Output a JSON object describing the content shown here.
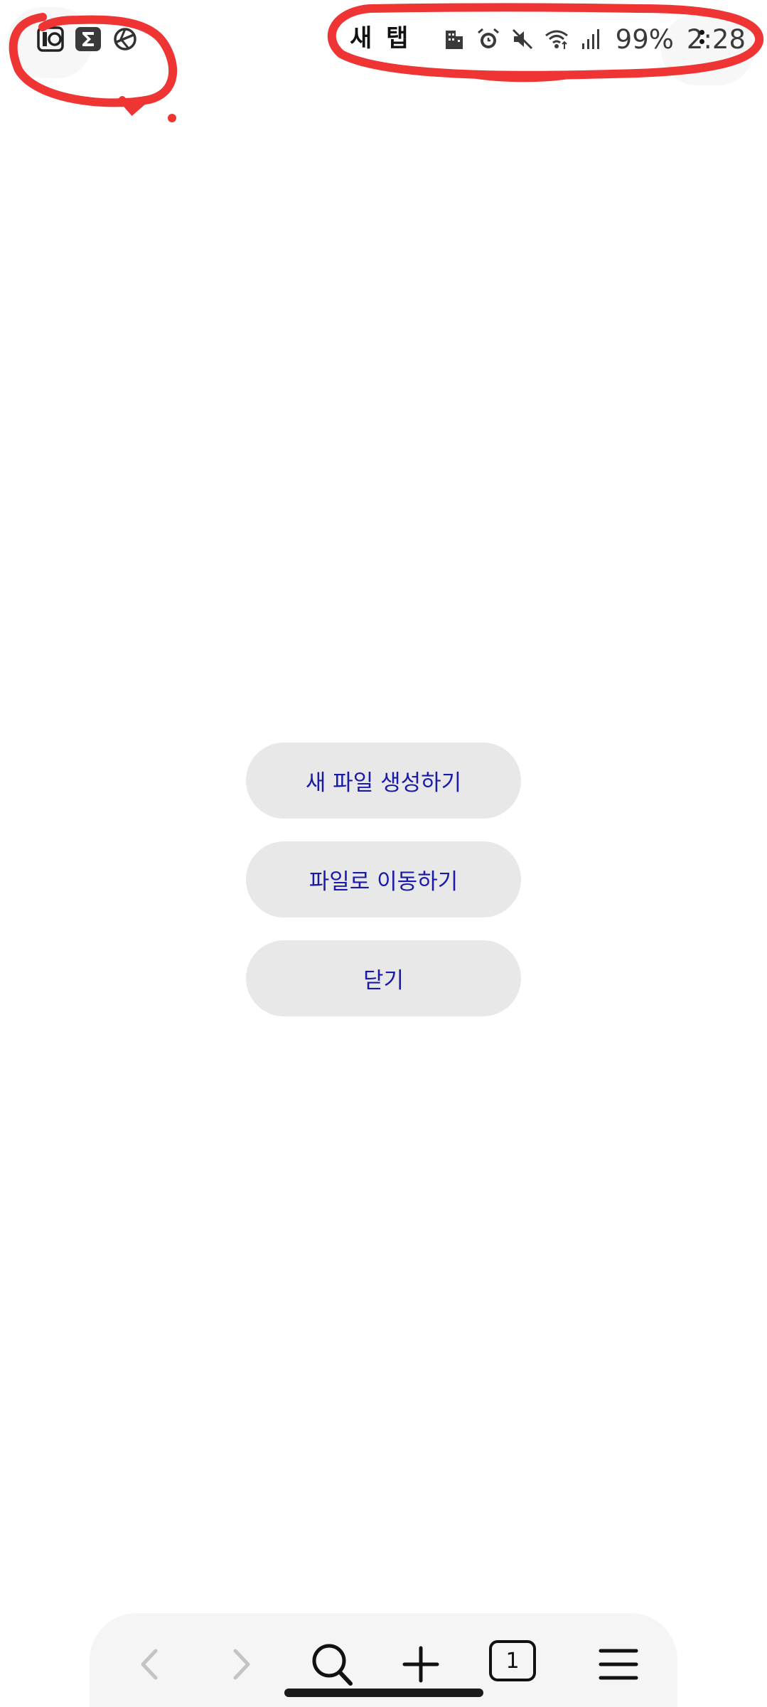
{
  "status_bar": {
    "tab_title": "새 탭",
    "battery": "99%",
    "time": "2:28",
    "left_icons": [
      "app-notification-icon",
      "sigma-app-icon",
      "network-app-icon"
    ],
    "right_icons": [
      "building-icon",
      "alarm-icon",
      "mute-icon",
      "wifi-icon",
      "signal-icon"
    ]
  },
  "dialog": {
    "new_file_label": "새 파일 생성하기",
    "go_to_file_label": "파일로 이동하기",
    "close_label": "닫기"
  },
  "toolbar": {
    "tab_count": "1",
    "icons": [
      "back-icon",
      "forward-icon",
      "search-icon",
      "add-icon",
      "tabs-icon",
      "menu-icon"
    ]
  },
  "colors": {
    "button_bg": "#e8e8e8",
    "button_text": "#1a1aa8",
    "annotation": "#ef3434"
  }
}
